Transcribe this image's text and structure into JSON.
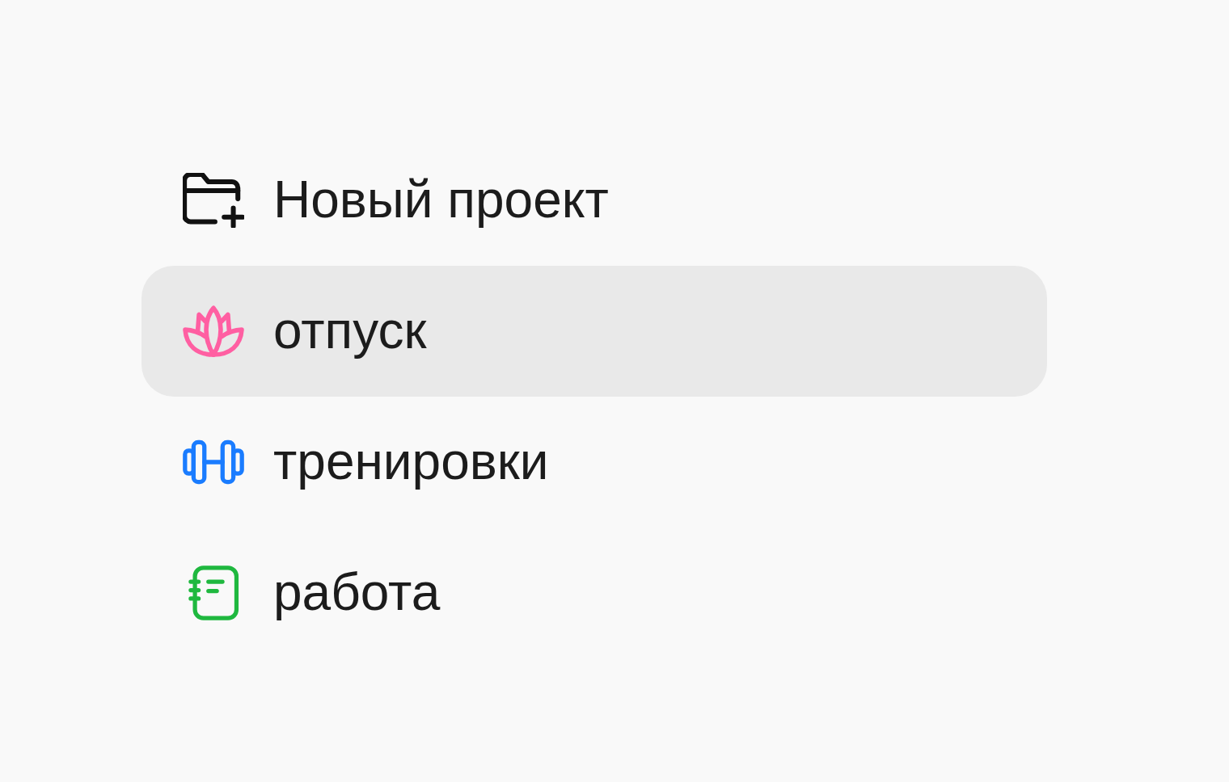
{
  "new_project": {
    "label": "Новый проект"
  },
  "projects": [
    {
      "label": "отпуск",
      "selected": true,
      "color": "#ff5fa2"
    },
    {
      "label": "тренировки",
      "selected": false,
      "color": "#1a7cff"
    },
    {
      "label": "работа",
      "selected": false,
      "color": "#1fb83f"
    }
  ]
}
